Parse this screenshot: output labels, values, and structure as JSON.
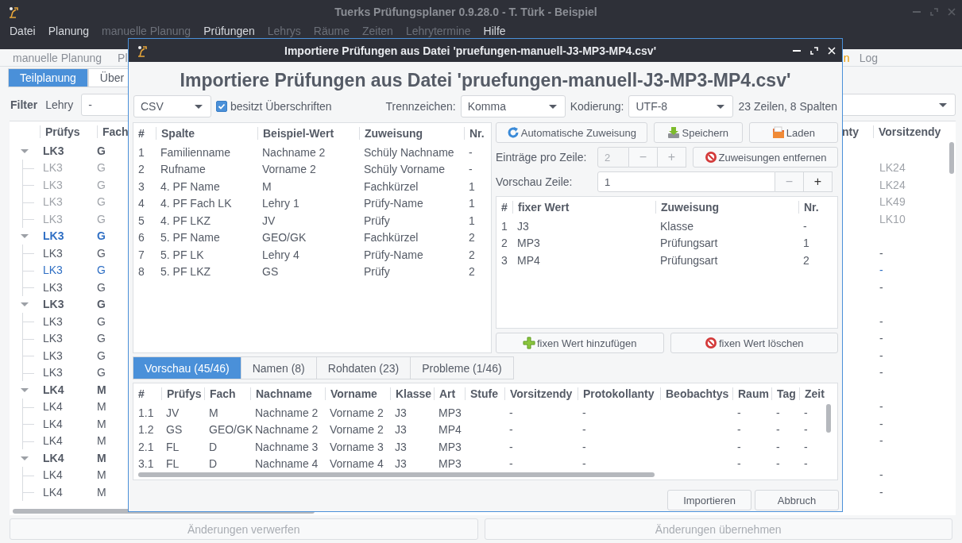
{
  "main_window": {
    "title": "Tuerks Prüfungsplaner 0.9.28.0 - T. Türk - Beispiel",
    "menu": [
      {
        "label": "Datei",
        "disabled": false
      },
      {
        "label": "Planung",
        "disabled": false
      },
      {
        "label": "manuelle Planung",
        "disabled": true
      },
      {
        "label": "Prüfungen",
        "disabled": false
      },
      {
        "label": "Lehrys",
        "disabled": true
      },
      {
        "label": "Räume",
        "disabled": true
      },
      {
        "label": "Zeiten",
        "disabled": true
      },
      {
        "label": "Lehrytermine",
        "disabled": true
      },
      {
        "label": "Hilfe",
        "disabled": false
      }
    ],
    "toolbar_left": [
      {
        "label": "manuelle Planung",
        "highlighted": false
      },
      {
        "label": "Pl",
        "highlighted": false
      }
    ],
    "toolbar_right": [
      {
        "label": "n",
        "highlighted": true
      },
      {
        "label": "Log",
        "highlighted": false
      }
    ],
    "tabs": [
      {
        "label": "Teilplanung",
        "selected": true
      },
      {
        "label": "Über",
        "selected": false
      }
    ],
    "filter": {
      "label": "Filter",
      "field_label": "Lehry",
      "value": "-"
    },
    "table": {
      "columns_left": [
        "Prüfys",
        "Fach"
      ],
      "columns_right": [
        "nty",
        "Vorsitzendy"
      ],
      "groups": [
        {
          "pruefys": "LK3",
          "fach": "G",
          "expanded": true,
          "highlighted": false,
          "children": [
            {
              "pruefys": "LK3",
              "fach": "G",
              "vorsitzendy": "LK24",
              "dimmed": true,
              "highlighted": false
            },
            {
              "pruefys": "LK3",
              "fach": "G",
              "vorsitzendy": "LK24",
              "dimmed": true,
              "highlighted": false
            },
            {
              "pruefys": "LK3",
              "fach": "G",
              "vorsitzendy": "LK49",
              "dimmed": true,
              "highlighted": false
            },
            {
              "pruefys": "LK3",
              "fach": "G",
              "vorsitzendy": "LK10",
              "dimmed": true,
              "highlighted": false
            }
          ]
        },
        {
          "pruefys": "LK3",
          "fach": "G",
          "expanded": true,
          "highlighted": true,
          "children": [
            {
              "pruefys": "LK3",
              "fach": "G",
              "vorsitzendy": "-",
              "dimmed": false,
              "highlighted": false
            },
            {
              "pruefys": "LK3",
              "fach": "G",
              "vorsitzendy": "-",
              "dimmed": false,
              "highlighted": true
            },
            {
              "pruefys": "LK3",
              "fach": "G",
              "vorsitzendy": "-",
              "dimmed": false,
              "highlighted": false
            }
          ]
        },
        {
          "pruefys": "LK3",
          "fach": "G",
          "expanded": true,
          "highlighted": false,
          "children": [
            {
              "pruefys": "LK3",
              "fach": "G",
              "vorsitzendy": "-",
              "dimmed": false,
              "highlighted": false
            },
            {
              "pruefys": "LK3",
              "fach": "G",
              "vorsitzendy": "-",
              "dimmed": false,
              "highlighted": false
            },
            {
              "pruefys": "LK3",
              "fach": "G",
              "vorsitzendy": "-",
              "dimmed": false,
              "highlighted": false
            },
            {
              "pruefys": "LK3",
              "fach": "G",
              "vorsitzendy": "-",
              "dimmed": false,
              "highlighted": false
            }
          ]
        },
        {
          "pruefys": "LK4",
          "fach": "M",
          "expanded": true,
          "highlighted": false,
          "children": [
            {
              "pruefys": "LK4",
              "fach": "M",
              "vorsitzendy": "-",
              "dimmed": false,
              "highlighted": false
            },
            {
              "pruefys": "LK4",
              "fach": "M",
              "vorsitzendy": "-",
              "dimmed": false,
              "highlighted": false
            },
            {
              "pruefys": "LK4",
              "fach": "M",
              "vorsitzendy": "-",
              "dimmed": false,
              "highlighted": false
            }
          ]
        },
        {
          "pruefys": "LK4",
          "fach": "M",
          "expanded": true,
          "highlighted": false,
          "children": [
            {
              "pruefys": "LK4",
              "fach": "M",
              "vorsitzendy": "-",
              "dimmed": false,
              "highlighted": false
            },
            {
              "pruefys": "LK4",
              "fach": "M",
              "vorsitzendy": "-",
              "dimmed": false,
              "highlighted": false
            }
          ]
        }
      ]
    },
    "bottom_buttons": [
      {
        "label": "Änderungen verwerfen",
        "disabled": true
      },
      {
        "label": "Änderungen übernehmen",
        "disabled": true
      }
    ]
  },
  "dialog": {
    "title": "Importiere Prüfungen aus Datei 'pruefungen-manuell-J3-MP3-MP4.csv'",
    "heading": "Importiere Prüfungen aus Datei 'pruefungen-manuell-J3-MP3-MP4.csv'",
    "format": "CSV",
    "header_checkbox": {
      "label": "besitzt Überschriften",
      "checked": true
    },
    "separator": {
      "label": "Trennzeichen:",
      "value": "Komma"
    },
    "encoding": {
      "label": "Kodierung:",
      "value": "UTF-8"
    },
    "summary": "23 Zeilen, 8 Spalten",
    "columns_table": {
      "headers": [
        "#",
        "Spalte",
        "Beispiel-Wert",
        "Zuweisung",
        "Nr."
      ],
      "rows": [
        [
          "1",
          "Familienname",
          "Nachname 2",
          "Schüly Nachname",
          "-"
        ],
        [
          "2",
          "Rufname",
          "Vorname 2",
          "Schüly Vorname",
          "-"
        ],
        [
          "3",
          "4. PF Name",
          "M",
          "Fachkürzel",
          "1"
        ],
        [
          "4",
          "4. PF Fach LK",
          "Lehry 1",
          "Prüfy-Name",
          "1"
        ],
        [
          "5",
          "4. PF LKZ",
          "JV",
          "Prüfy",
          "1"
        ],
        [
          "6",
          "5. PF Name",
          "GEO/GK",
          "Fachkürzel",
          "2"
        ],
        [
          "7",
          "5. PF LK",
          "Lehry 4",
          "Prüfy-Name",
          "2"
        ],
        [
          "8",
          "5. PF LKZ",
          "GS",
          "Prüfy",
          "2"
        ]
      ]
    },
    "action_buttons": [
      {
        "label": "Automatische Zuweisung",
        "kind": "refresh"
      },
      {
        "label": "Speichern",
        "kind": "save"
      },
      {
        "label": "Laden",
        "kind": "load"
      }
    ],
    "entries_per_row": {
      "label": "Einträge pro Zeile:",
      "value": "2",
      "disabled": true,
      "minus": {
        "label": "−",
        "disabled": true
      },
      "plus": {
        "label": "+",
        "disabled": true
      }
    },
    "remove_button": {
      "label": "Zuweisungen entfernen",
      "kind": "remove"
    },
    "preview_row": {
      "label": "Vorschau Zeile:",
      "value": "1",
      "disabled": false,
      "minus": {
        "label": "−",
        "disabled": true
      },
      "plus": {
        "label": "+",
        "disabled": false
      }
    },
    "fixed_table": {
      "headers": [
        "#",
        "fixer Wert",
        "Zuweisung",
        "Nr."
      ],
      "rows": [
        [
          "1",
          "J3",
          "Klasse",
          "-"
        ],
        [
          "2",
          "MP3",
          "Prüfungsart",
          "1"
        ],
        [
          "3",
          "MP4",
          "Prüfungsart",
          "2"
        ]
      ]
    },
    "fixed_buttons": [
      {
        "label": "fixen Wert hinzufügen",
        "kind": "add"
      },
      {
        "label": "fixen Wert löschen",
        "kind": "remove"
      }
    ],
    "tabs": [
      {
        "label": "Vorschau (45/46)",
        "selected": true
      },
      {
        "label": "Namen (8)",
        "selected": false
      },
      {
        "label": "Rohdaten (23)",
        "selected": false
      },
      {
        "label": "Probleme (1/46)",
        "selected": false
      }
    ],
    "preview_table": {
      "headers": [
        "#",
        "Prüfys",
        "Fach",
        "Nachname",
        "Vorname",
        "Klasse",
        "Art",
        "Stufe",
        "Vorsitzendy",
        "Protokollanty",
        "Beobachtys",
        "Raum",
        "Tag",
        "Zeit"
      ],
      "rows": [
        [
          "1.1",
          "JV",
          "M",
          "Nachname 2",
          "Vorname 2",
          "J3",
          "MP3",
          null,
          "-",
          "-",
          null,
          "-",
          "-",
          "-"
        ],
        [
          "1.2",
          "GS",
          "GEO/GK",
          "Nachname 2",
          "Vorname 2",
          "J3",
          "MP4",
          null,
          "-",
          "-",
          null,
          "-",
          "-",
          "-"
        ],
        [
          "2.1",
          "FL",
          "D",
          "Nachname 3",
          "Vorname 3",
          "J3",
          "MP3",
          null,
          "-",
          "-",
          null,
          "-",
          "-",
          "-"
        ],
        [
          "3.1",
          "FL",
          "D",
          "Nachname 4",
          "Vorname 4",
          "J3",
          "MP3",
          null,
          "-",
          "-",
          null,
          "-",
          "-",
          "-"
        ]
      ]
    },
    "footer_buttons": [
      "Importieren",
      "Abbruch"
    ]
  }
}
